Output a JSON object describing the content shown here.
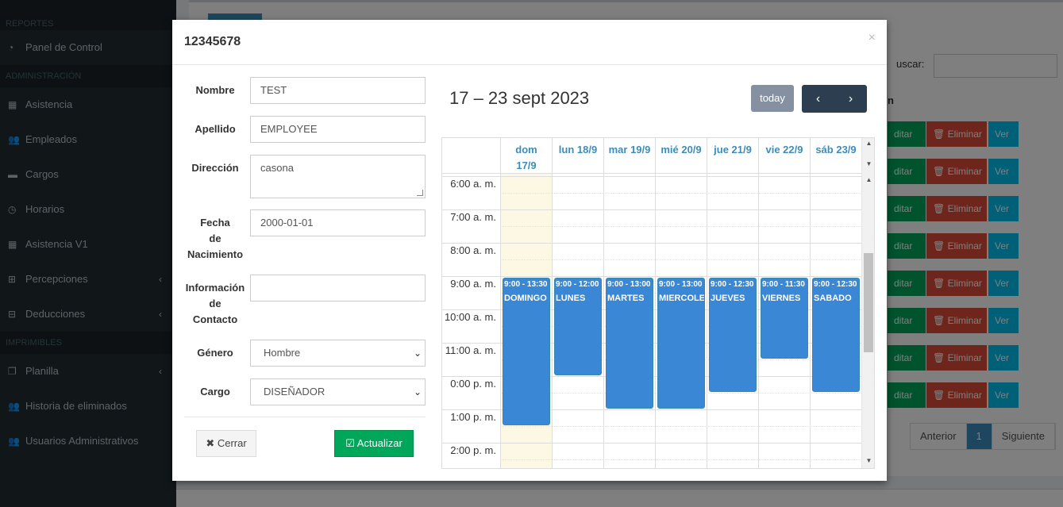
{
  "sidebar": {
    "sections": [
      "REPORTES",
      "ADMINISTRACIÓN",
      "IMPRIMIBLES"
    ],
    "items": [
      {
        "label": "Panel de Control",
        "icon": "dashboard-icon",
        "glyph": "◔"
      },
      {
        "label": "Asistencia",
        "icon": "calendar-icon",
        "glyph": "▦"
      },
      {
        "label": "Empleados",
        "icon": "users-icon",
        "glyph": "👥"
      },
      {
        "label": "Cargos",
        "icon": "briefcase-icon",
        "glyph": "▬"
      },
      {
        "label": "Horarios",
        "icon": "clock-icon",
        "glyph": "◷"
      },
      {
        "label": "Asistencia V1",
        "icon": "calendar-icon",
        "glyph": "▦"
      },
      {
        "label": "Percepciones",
        "icon": "plus-square-icon",
        "glyph": "⊞"
      },
      {
        "label": "Deducciones",
        "icon": "minus-square-icon",
        "glyph": "⊟"
      },
      {
        "label": "Planilla",
        "icon": "files-icon",
        "glyph": "❐"
      },
      {
        "label": "Historia de eliminados",
        "icon": "users-icon",
        "glyph": "👥"
      },
      {
        "label": "Usuarios Administrativos",
        "icon": "users-icon",
        "glyph": "👥"
      }
    ]
  },
  "background": {
    "search_label": "uscar:",
    "table_header": "n",
    "row_buttons": {
      "edit": "ditar",
      "delete": "🗑 Eliminar",
      "view": "Ver"
    },
    "pager": {
      "prev": "Anterior",
      "page": "1",
      "next": "Siguiente"
    }
  },
  "modal": {
    "title": "12345678",
    "close_glyph": "×",
    "form": {
      "nombre": {
        "label": "Nombre",
        "value": "TEST"
      },
      "apellido": {
        "label": "Apellido",
        "value": "EMPLOYEE"
      },
      "direccion": {
        "label": "Dirección",
        "value": "casona"
      },
      "fecha_nacimiento": {
        "label_lines": [
          "Fecha",
          "de",
          "Nacimiento"
        ],
        "value": "2000-01-01"
      },
      "info_contacto": {
        "label_lines": [
          "Información",
          "de",
          "Contacto"
        ],
        "value": ""
      },
      "genero": {
        "label": "Género",
        "value": "Hombre"
      },
      "cargo": {
        "label": "Cargo",
        "value": "DISEÑADOR"
      }
    },
    "buttons": {
      "cerrar": "✖ Cerrar",
      "actualizar": "☑ Actualizar"
    }
  },
  "calendar": {
    "title": "17 – 23 sept 2023",
    "today_label": "today",
    "prev_glyph": "‹",
    "next_glyph": "›",
    "days": [
      {
        "line1": "dom",
        "line2": "17/9",
        "today": true
      },
      {
        "line1": "lun 18/9",
        "line2": ""
      },
      {
        "line1": "mar 19/9",
        "line2": ""
      },
      {
        "line1": "mié 20/9",
        "line2": ""
      },
      {
        "line1": "jue 21/9",
        "line2": ""
      },
      {
        "line1": "vie 22/9",
        "line2": ""
      },
      {
        "line1": "sáb 23/9",
        "line2": ""
      }
    ],
    "time_labels": [
      "6:00 a. m.",
      "7:00 a. m.",
      "8:00 a. m.",
      "9:00 a. m.",
      "10:00 a. m.",
      "11:00 a. m.",
      "0:00 p. m.",
      "1:00 p. m.",
      "2:00 p. m."
    ],
    "first_hour": 6,
    "events": [
      {
        "day": 0,
        "start": 9.0,
        "end": 13.5,
        "time": "9:00 - 13:30",
        "title": "DOMINGO"
      },
      {
        "day": 1,
        "start": 9.0,
        "end": 12.0,
        "time": "9:00 - 12:00",
        "title": "LUNES"
      },
      {
        "day": 2,
        "start": 9.0,
        "end": 13.0,
        "time": "9:00 - 13:00",
        "title": "MARTES"
      },
      {
        "day": 3,
        "start": 9.0,
        "end": 13.0,
        "time": "9:00 - 13:00",
        "title": "MIERCOLES"
      },
      {
        "day": 4,
        "start": 9.0,
        "end": 12.5,
        "time": "9:00 - 12:30",
        "title": "JUEVES"
      },
      {
        "day": 5,
        "start": 9.0,
        "end": 11.5,
        "time": "9:00 - 11:30",
        "title": "VIERNES"
      },
      {
        "day": 6,
        "start": 9.0,
        "end": 12.5,
        "time": "9:00 - 12:30",
        "title": "SABADO"
      }
    ],
    "colors": {
      "event": "#3a87d6",
      "today_bg": "#fcf8e3",
      "nav": "#2c3e50",
      "today_btn": "#8591a0"
    }
  }
}
